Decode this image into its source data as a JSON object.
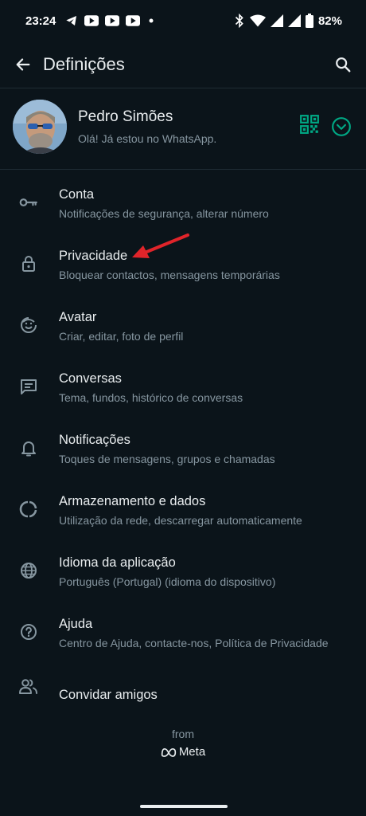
{
  "status_bar": {
    "time": "23:24",
    "battery": "82%",
    "icons_left": [
      "telegram-icon",
      "youtube-icon",
      "youtube-icon",
      "youtube-icon",
      "dot-icon"
    ],
    "icons_right": [
      "bluetooth-icon",
      "wifi-icon",
      "signal-icon",
      "signal-icon",
      "battery-icon"
    ]
  },
  "app_bar": {
    "title": "Definições"
  },
  "profile": {
    "name": "Pedro Simões",
    "status": "Olá! Já estou no WhatsApp."
  },
  "settings": [
    {
      "title": "Conta",
      "subtitle": "Notificações de segurança, alterar número",
      "icon": "key-icon"
    },
    {
      "title": "Privacidade",
      "subtitle": "Bloquear contactos, mensagens temporárias",
      "icon": "lock-icon"
    },
    {
      "title": "Avatar",
      "subtitle": "Criar, editar, foto de perfil",
      "icon": "avatar-icon"
    },
    {
      "title": "Conversas",
      "subtitle": "Tema, fundos, histórico de conversas",
      "icon": "chat-icon"
    },
    {
      "title": "Notificações",
      "subtitle": "Toques de mensagens, grupos e chamadas",
      "icon": "bell-icon"
    },
    {
      "title": "Armazenamento e dados",
      "subtitle": "Utilização da rede, descarregar automaticamente",
      "icon": "storage-icon"
    },
    {
      "title": "Idioma da aplicação",
      "subtitle": "Português (Portugal) (idioma do dispositivo)",
      "icon": "globe-icon"
    },
    {
      "title": "Ajuda",
      "subtitle": "Centro de Ajuda, contacte-nos, Política de Privacidade",
      "icon": "help-icon"
    },
    {
      "title": "Convidar amigos",
      "icon": "people-icon"
    }
  ],
  "footer": {
    "from": "from",
    "brand": "Meta"
  },
  "colors": {
    "background": "#0b141a",
    "accent": "#00a884",
    "annotation_arrow": "#e0242a",
    "primary_text": "#e9edef",
    "secondary_text": "#8696a0"
  }
}
